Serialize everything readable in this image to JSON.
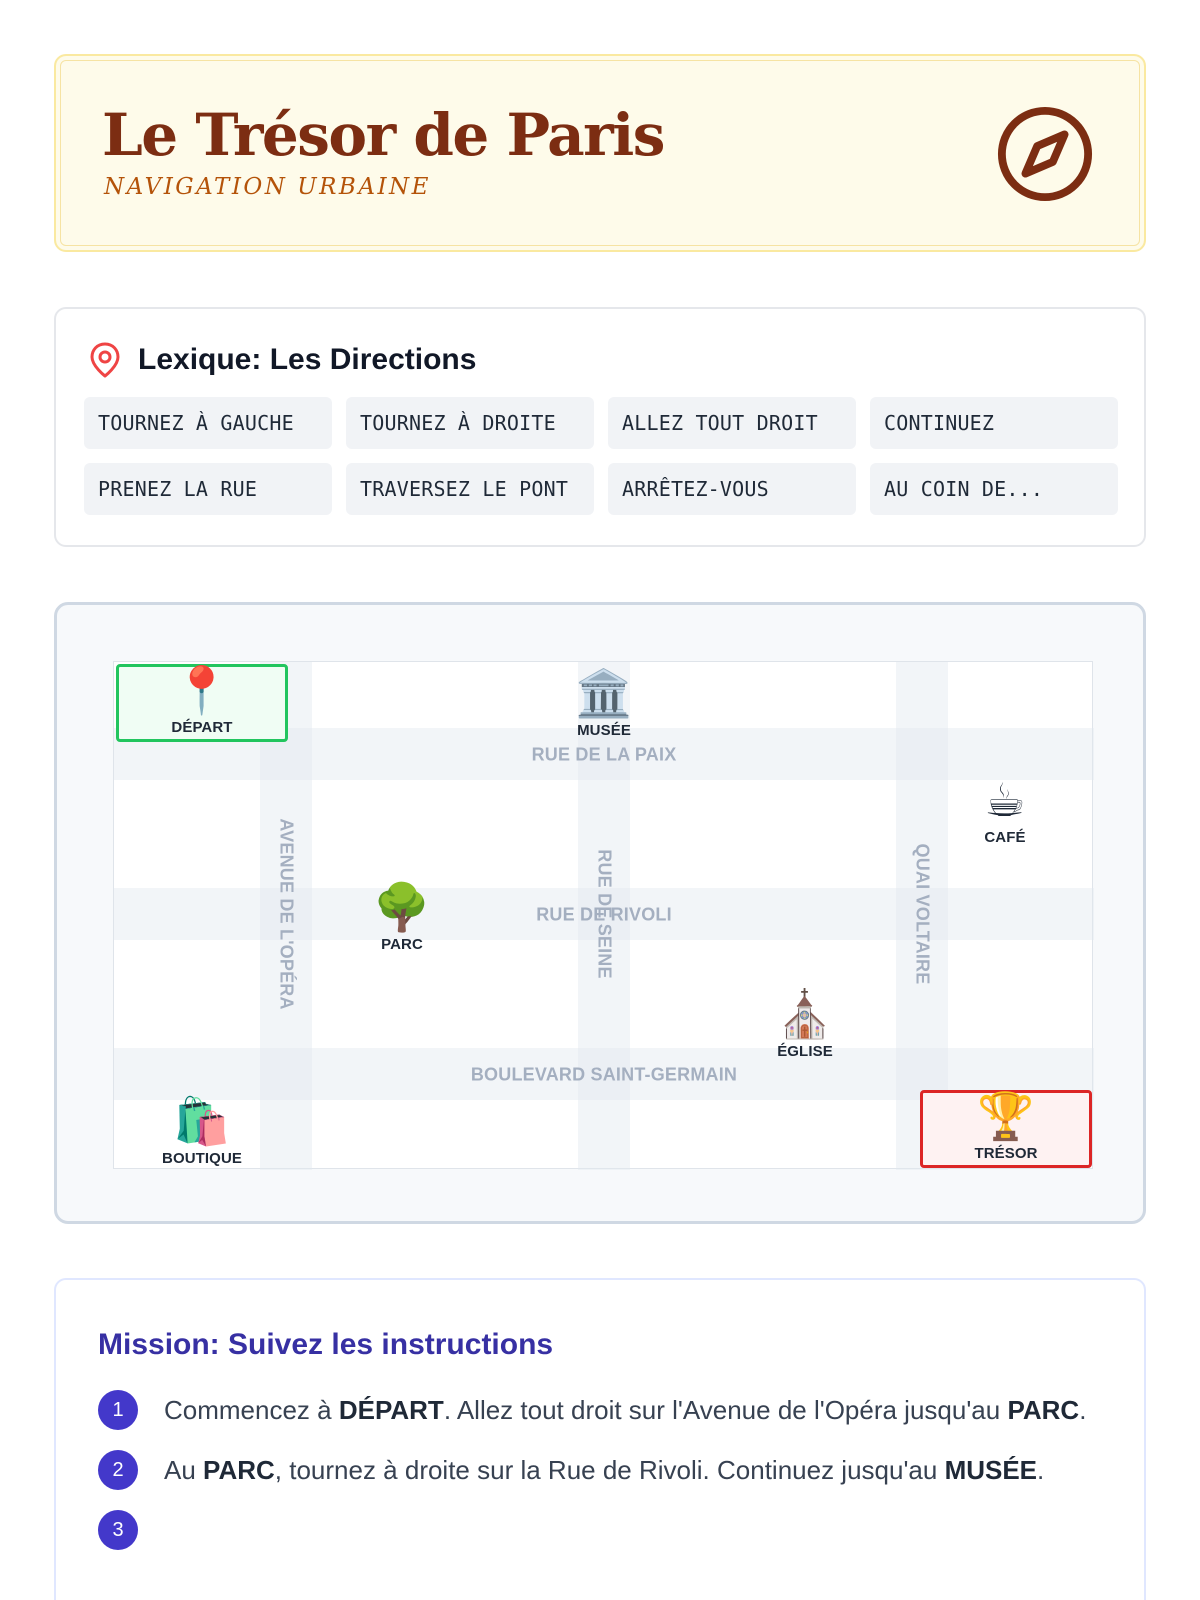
{
  "header": {
    "title": "Le Trésor de Paris",
    "subtitle": "NAVIGATION URBAINE",
    "icon": "compass-icon"
  },
  "lexicon": {
    "title": "Lexique: Les Directions",
    "icon": "map-pin-icon",
    "terms": [
      "TOURNEZ À GAUCHE",
      "TOURNEZ À DROITE",
      "ALLEZ TOUT DROIT",
      "CONTINUEZ",
      "PRENEZ LA RUE",
      "TRAVERSEZ LE PONT",
      "ARRÊTEZ-VOUS",
      "AU COIN DE..."
    ]
  },
  "map": {
    "streets": {
      "rue_de_la_paix": "RUE DE LA PAIX",
      "rue_de_rivoli": "RUE DE RIVOLI",
      "boulevard_saint_germain": "BOULEVARD SAINT-GERMAIN",
      "avenue_de_l_opera": "AVENUE DE L'OPÉRA",
      "rue_de_seine": "RUE DE SEINE",
      "quai_voltaire": "QUAI VOLTAIRE"
    },
    "places": {
      "depart": {
        "label": "DÉPART",
        "emoji": "📍"
      },
      "musee": {
        "label": "MUSÉE",
        "emoji": "🏛️"
      },
      "cafe": {
        "label": "CAFÉ",
        "emoji": "☕"
      },
      "parc": {
        "label": "PARC",
        "emoji": "🌳"
      },
      "eglise": {
        "label": "ÉGLISE",
        "emoji": "⛪"
      },
      "boutique": {
        "label": "BOUTIQUE",
        "emoji": "🛍️"
      },
      "tresor": {
        "label": "TRÉSOR",
        "emoji": "🏆"
      }
    }
  },
  "mission": {
    "title": "Mission: Suivez les instructions",
    "steps": [
      {
        "number": "1",
        "t1": "Commencez à ",
        "b1": "DÉPART",
        "t2": ". Allez tout droit sur l'Avenue de l'Opéra jusqu'au ",
        "b2": "PARC",
        "t3": "."
      },
      {
        "number": "2",
        "t1": "Au ",
        "b1": "PARC",
        "t2": ", tournez à droite sur la Rue de Rivoli. Continuez jusqu'au ",
        "b2": "MUSÉE",
        "t3": "."
      },
      {
        "number": "3"
      }
    ]
  }
}
